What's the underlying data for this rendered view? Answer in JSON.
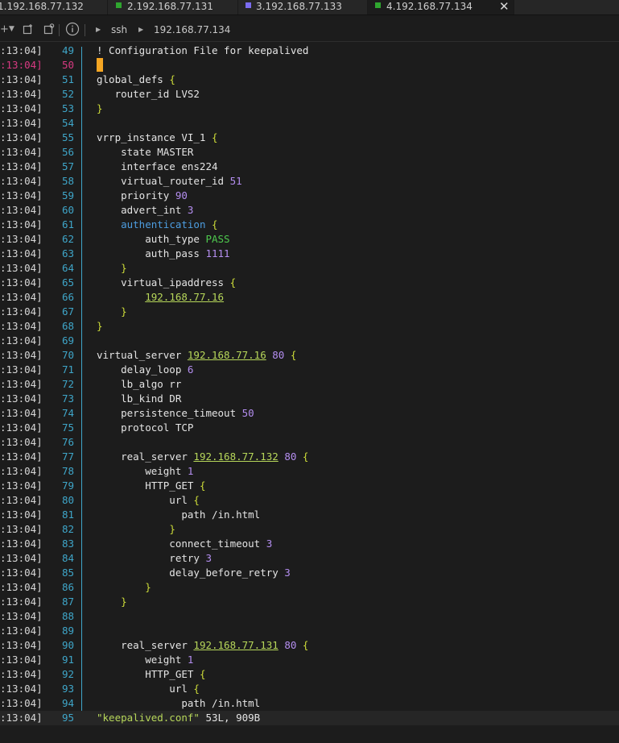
{
  "tabs": [
    {
      "label": "1.192.168.77.132",
      "color": "#2fa52f",
      "active": false
    },
    {
      "label": "2.192.168.77.131",
      "color": "#2fa52f",
      "active": false
    },
    {
      "label": "3.192.168.77.133",
      "color": "#7b6cf0",
      "active": false
    },
    {
      "label": "4.192.168.77.134",
      "color": "#2fa52f",
      "active": true
    }
  ],
  "tab_close": "✕",
  "toolbar": {
    "breadcrumb": [
      "ssh",
      "192.168.77.134"
    ]
  },
  "colors": {
    "line_number": "#3fa6c9",
    "current_line": "#d83a82",
    "cursor": "#f5a623",
    "number": "#b48ef0",
    "ip": "#b7d75a",
    "brace": "#cddc39",
    "keyword": "#4d9de0"
  },
  "editor": {
    "timestamp": ":13:04]",
    "current_line": "50",
    "status_text": "\"keepalived.conf\" 53L, 909B",
    "lines": [
      {
        "n": "49",
        "text": "! Configuration File for keepalived"
      },
      {
        "n": "50",
        "text": ""
      },
      {
        "n": "51",
        "text": "global_defs {"
      },
      {
        "n": "52",
        "text": "   router_id LVS2"
      },
      {
        "n": "53",
        "text": "}"
      },
      {
        "n": "54",
        "text": ""
      },
      {
        "n": "55",
        "text": "vrrp_instance VI_1 {"
      },
      {
        "n": "56",
        "text": "    state MASTER"
      },
      {
        "n": "57",
        "text": "    interface ens224"
      },
      {
        "n": "58",
        "text": "    virtual_router_id 51"
      },
      {
        "n": "59",
        "text": "    priority 90"
      },
      {
        "n": "60",
        "text": "    advert_int 3"
      },
      {
        "n": "61",
        "text": "    authentication {"
      },
      {
        "n": "62",
        "text": "        auth_type PASS"
      },
      {
        "n": "63",
        "text": "        auth_pass 1111"
      },
      {
        "n": "64",
        "text": "    }"
      },
      {
        "n": "65",
        "text": "    virtual_ipaddress {"
      },
      {
        "n": "66",
        "text": "        192.168.77.16"
      },
      {
        "n": "67",
        "text": "    }"
      },
      {
        "n": "68",
        "text": "}"
      },
      {
        "n": "69",
        "text": ""
      },
      {
        "n": "70",
        "text": "virtual_server 192.168.77.16 80 {"
      },
      {
        "n": "71",
        "text": "    delay_loop 6"
      },
      {
        "n": "72",
        "text": "    lb_algo rr"
      },
      {
        "n": "73",
        "text": "    lb_kind DR"
      },
      {
        "n": "74",
        "text": "    persistence_timeout 50"
      },
      {
        "n": "75",
        "text": "    protocol TCP"
      },
      {
        "n": "76",
        "text": ""
      },
      {
        "n": "77",
        "text": "    real_server 192.168.77.132 80 {"
      },
      {
        "n": "78",
        "text": "        weight 1"
      },
      {
        "n": "79",
        "text": "        HTTP_GET {"
      },
      {
        "n": "80",
        "text": "            url {"
      },
      {
        "n": "81",
        "text": "              path /in.html"
      },
      {
        "n": "82",
        "text": "            }"
      },
      {
        "n": "83",
        "text": "            connect_timeout 3"
      },
      {
        "n": "84",
        "text": "            retry 3"
      },
      {
        "n": "85",
        "text": "            delay_before_retry 3"
      },
      {
        "n": "86",
        "text": "        }"
      },
      {
        "n": "87",
        "text": "    }"
      },
      {
        "n": "88",
        "text": ""
      },
      {
        "n": "89",
        "text": ""
      },
      {
        "n": "90",
        "text": "    real_server 192.168.77.131 80 {"
      },
      {
        "n": "91",
        "text": "        weight 1"
      },
      {
        "n": "92",
        "text": "        HTTP_GET {"
      },
      {
        "n": "93",
        "text": "            url {"
      },
      {
        "n": "94",
        "text": "              path /in.html"
      },
      {
        "n": "95",
        "text": "\"keepalived.conf\" 53L, 909B"
      }
    ]
  }
}
